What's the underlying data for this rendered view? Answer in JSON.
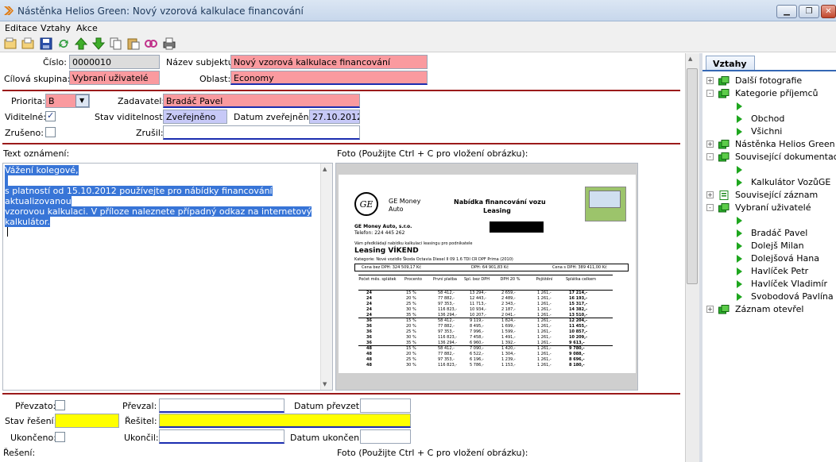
{
  "window": {
    "title": "Nástěnka Helios Green: Nový vzorová kalkulace financování"
  },
  "menu": [
    "Editace",
    "Vztahy",
    "Akce"
  ],
  "form": {
    "cislo_label": "Číslo:",
    "cislo_value": "0000010",
    "nazev_label": "Název subjektu:",
    "nazev_value": "Nový vzorová kalkulace financování",
    "cilova_label": "Cílová skupina:",
    "cilova_value": "Vybraní uživatelé",
    "oblast_label": "Oblast:",
    "oblast_value": "Economy",
    "priorita_label": "Priorita:",
    "priorita_value": "B",
    "zadavatel_label": "Zadavatel:",
    "zadavatel_value": "Bradáč Pavel",
    "viditelne_label": "Viditelné:",
    "viditelne_checked": true,
    "stav_vid_label": "Stav viditelnosti:",
    "stav_vid_value": "Zveřejněno",
    "datum_zv_label": "Datum zveřejnění:",
    "datum_zv_value": "27.10.2012",
    "zruseno_label": "Zrušeno:",
    "zrusil_label": "Zrušil:",
    "text_label": "Text oznámení:",
    "foto_label": "Foto (Použijte Ctrl + C pro vložení obrázku):",
    "text_line1": "Vážení kolegové,",
    "text_line2": "s platností od 15.10.2012 používejte pro nábídky financování aktualizovanou",
    "text_line3": "vzorovou kalkulaci. V příloze naleznete případný odkaz na internetový kalkulátor.",
    "prevzato_label": "Převzato:",
    "prevzal_label": "Převzal:",
    "datum_prevzeti_label": "Datum převzetí:",
    "stav_reseni_label": "Stav řešení:",
    "resitel_label": "Řešitel:",
    "ukonceno_label": "Ukončeno:",
    "ukoncil_label": "Ukončil:",
    "datum_ukonceni_label": "Datum ukončení:",
    "reseni_label": "Řešení:",
    "foto2_label": "Foto (Použijte Ctrl + C pro vložení obrázku):"
  },
  "doc": {
    "brand1": "GE Money",
    "brand2": "Auto",
    "heading1": "Nabídka financování vozu",
    "heading2": "Leasing",
    "company": "GE Money Auto, s.r.o.",
    "phone": "Telefon: 224 445 262",
    "intro": "Vám předkládají nabídku kalkulaci leasingu pro podnikatele",
    "product": "Leasing VÍKEND",
    "category": "Kategorie: Nové vozidlo    Škoda Octavia Diesel II 09 1.6 TDI CR DPF Prima (2010)",
    "price_bez": "Cena bez DPH: 324 509,17 Kč",
    "dph": "DPH: 64 901,83 Kč",
    "price_s": "Cena s DPH: 389 411,00 Kč",
    "cols": [
      "Počet měs. splátek",
      "Procento",
      "První platba",
      "Spl. bez DPH",
      "DPH 20 %",
      "Pojištění",
      "Splátka celkem"
    ],
    "rows": [
      [
        "24",
        "15 %",
        "58 412,-",
        "13 294,-",
        "2 659,-",
        "1 261,-",
        "17 214,-"
      ],
      [
        "24",
        "20 %",
        "77 882,-",
        "12 443,-",
        "2 489,-",
        "1 261,-",
        "16 193,-"
      ],
      [
        "24",
        "25 %",
        "97 353,-",
        "11 713,-",
        "2 343,-",
        "1 261,-",
        "15 317,-"
      ],
      [
        "24",
        "30 %",
        "116 823,-",
        "10 934,-",
        "2 187,-",
        "1 261,-",
        "14 382,-"
      ],
      [
        "24",
        "35 %",
        "136 294,-",
        "10 207,-",
        "2 041,-",
        "1 261,-",
        "13 510,-"
      ],
      [
        "36",
        "15 %",
        "58 412,-",
        "9 119,-",
        "1 824,-",
        "1 261,-",
        "12 204,-"
      ],
      [
        "36",
        "20 %",
        "77 882,-",
        "8 495,-",
        "1 699,-",
        "1 261,-",
        "11 455,-"
      ],
      [
        "36",
        "25 %",
        "97 353,-",
        "7 996,-",
        "1 599,-",
        "1 261,-",
        "10 857,-"
      ],
      [
        "36",
        "30 %",
        "116 823,-",
        "7 458,-",
        "1 491,-",
        "1 261,-",
        "10 209,-"
      ],
      [
        "36",
        "35 %",
        "136 294,-",
        "6 960,-",
        "1 392,-",
        "1 261,-",
        "9 613,-"
      ],
      [
        "48",
        "15 %",
        "58 412,-",
        "7 090,-",
        "1 420,-",
        "1 261,-",
        "9 780,-"
      ],
      [
        "48",
        "20 %",
        "77 882,-",
        "6 522,-",
        "1 304,-",
        "1 261,-",
        "9 088,-"
      ],
      [
        "48",
        "25 %",
        "97 353,-",
        "6 196,-",
        "1 239,-",
        "1 261,-",
        "8 696,-"
      ],
      [
        "48",
        "30 %",
        "116 823,-",
        "5 786,-",
        "1 153,-",
        "1 261,-",
        "8 180,-"
      ]
    ]
  },
  "relations": {
    "tab": "Vztahy",
    "tree": [
      {
        "level": 0,
        "exp": "+",
        "icon": "doc-icon",
        "label": "Další fotografie"
      },
      {
        "level": 0,
        "exp": "-",
        "icon": "doc-icon",
        "label": "Kategorie příjemců"
      },
      {
        "level": 1,
        "exp": "",
        "icon": "tri",
        "label": ""
      },
      {
        "level": 1,
        "exp": "",
        "icon": "tri",
        "label": "Obchod"
      },
      {
        "level": 1,
        "exp": "",
        "icon": "tri",
        "label": "Všichni"
      },
      {
        "level": 0,
        "exp": "+",
        "icon": "doc-icon",
        "label": "Nástěnka Helios Green"
      },
      {
        "level": 0,
        "exp": "-",
        "icon": "doc-icon",
        "label": "Související dokumentace"
      },
      {
        "level": 1,
        "exp": "",
        "icon": "tri",
        "label": ""
      },
      {
        "level": 1,
        "exp": "",
        "icon": "tri",
        "label": "Kalkulátor VozůGE"
      },
      {
        "level": 0,
        "exp": "+",
        "icon": "list-icon",
        "label": "Související záznam"
      },
      {
        "level": 0,
        "exp": "-",
        "icon": "doc-icon",
        "label": "Vybraní uživatelé"
      },
      {
        "level": 1,
        "exp": "",
        "icon": "tri",
        "label": ""
      },
      {
        "level": 1,
        "exp": "",
        "icon": "tri",
        "label": "Bradáč Pavel"
      },
      {
        "level": 1,
        "exp": "",
        "icon": "tri",
        "label": "Dolejš Milan"
      },
      {
        "level": 1,
        "exp": "",
        "icon": "tri",
        "label": "Dolejšová Hana"
      },
      {
        "level": 1,
        "exp": "",
        "icon": "tri",
        "label": "Havlíček Petr"
      },
      {
        "level": 1,
        "exp": "",
        "icon": "tri",
        "label": "Havlíček Vladimír"
      },
      {
        "level": 1,
        "exp": "",
        "icon": "tri",
        "label": "Svobodová Pavlína"
      },
      {
        "level": 0,
        "exp": "+",
        "icon": "doc-icon",
        "label": "Záznam otevřel"
      }
    ]
  },
  "colors": {
    "required": "#fa9a9f",
    "readonly": "#dcdcdc",
    "info": "#c7c9f7",
    "status": "#ffff00",
    "separator": "#9b1a1a",
    "tree_icon": "#1ea61e"
  }
}
